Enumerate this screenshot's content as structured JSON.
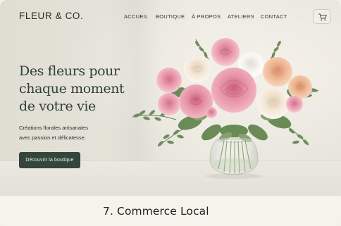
{
  "brand": {
    "name": "FLEUR & CO."
  },
  "nav": {
    "items": [
      {
        "label": "ACCUEIL"
      },
      {
        "label": "BOUTIQUE"
      },
      {
        "label": "À PROPOS"
      },
      {
        "label": "ATELIERS"
      },
      {
        "label": "CONTACT"
      }
    ],
    "cart_icon": "cart-icon"
  },
  "hero": {
    "headline_lines": [
      "Des fleurs pour",
      "chaque moment",
      "de votre vie"
    ],
    "subtext_lines": [
      "Créations florales artisanales",
      "avec passion et délicatesse."
    ],
    "cta_label": "Découvrir la boutique",
    "image": "flower-bouquet-in-glass-vase"
  },
  "caption": {
    "text": "7. Commerce Local"
  },
  "colors": {
    "accent": "#34463c",
    "headline": "#2f4138",
    "rose_pink": "#e89aac",
    "peach": "#f0c4a6",
    "cream": "#f6ece0",
    "leaf": "#5f7d4e"
  }
}
